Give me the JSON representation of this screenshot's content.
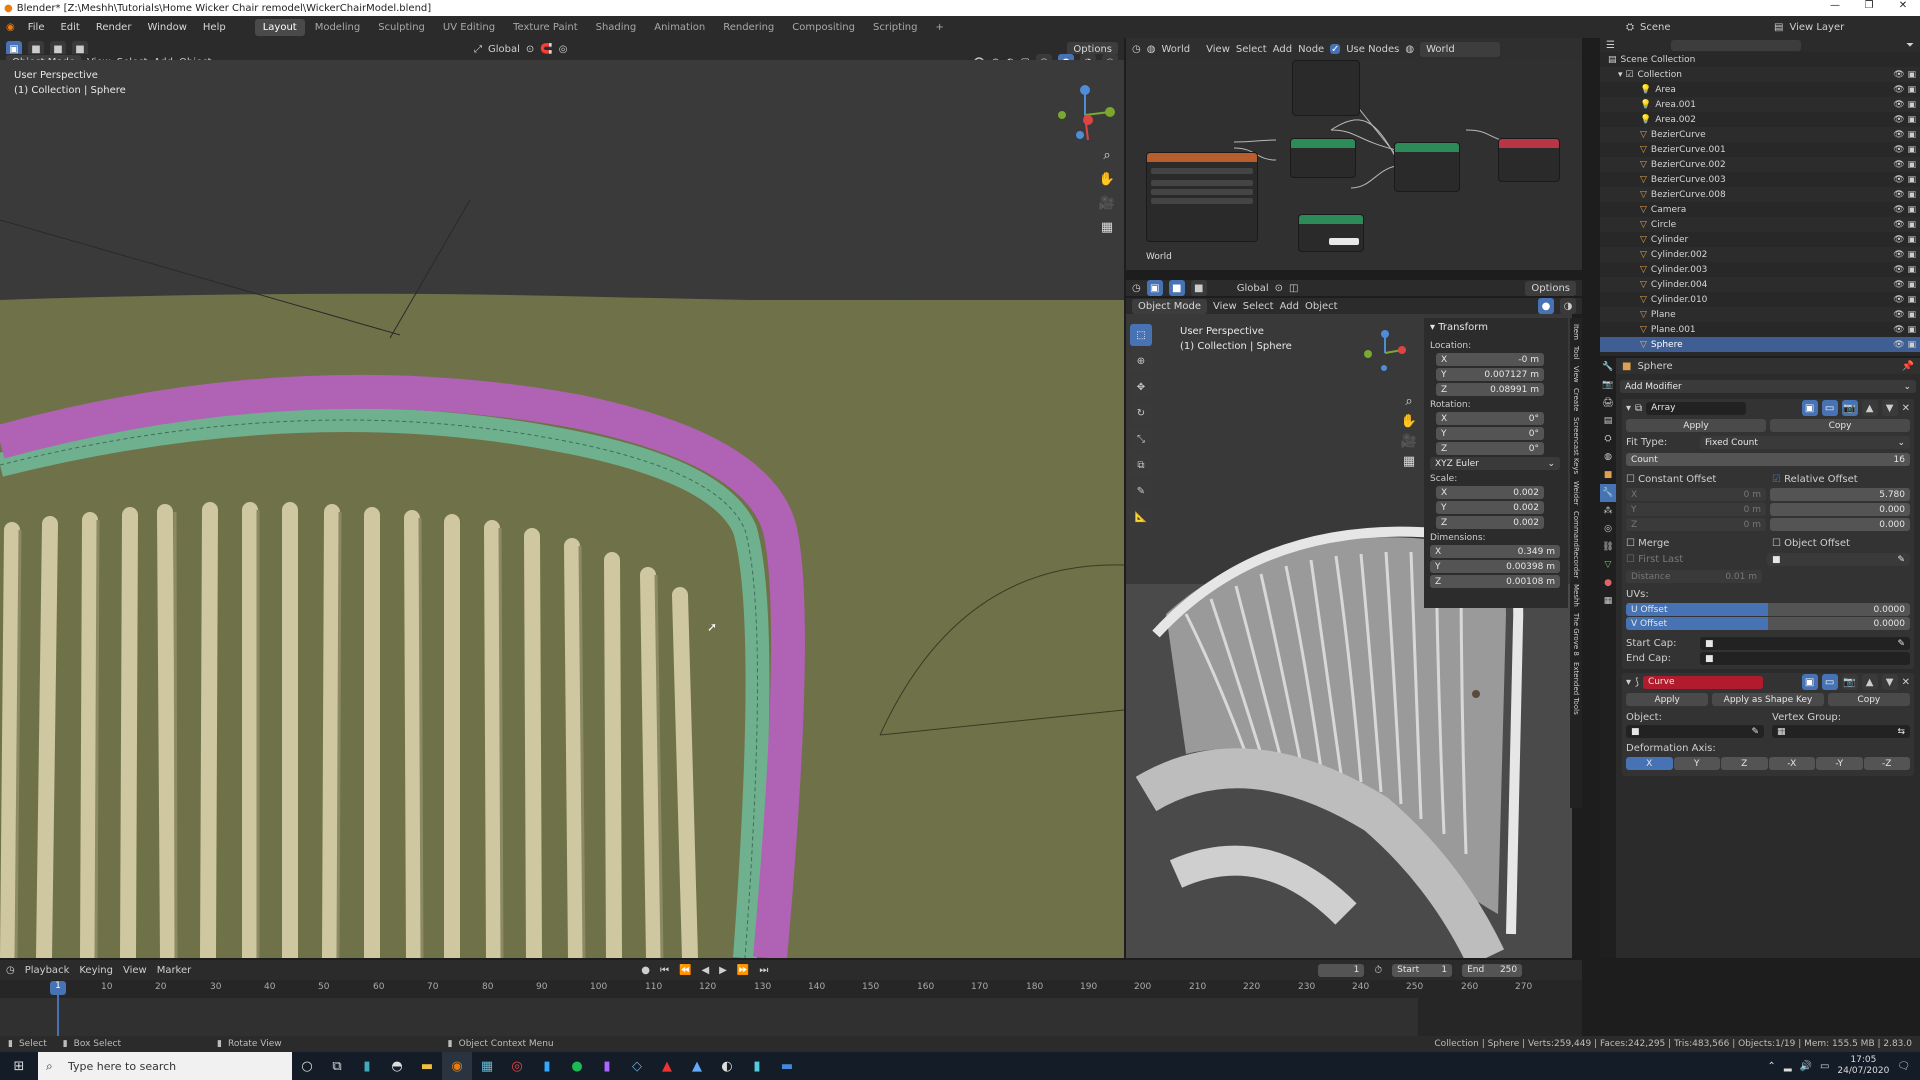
{
  "window": {
    "title": "Blender* [Z:\\Meshh\\Tutorials\\Home Wicker Chair remodel\\WickerChairModel.blend]"
  },
  "menus": [
    "File",
    "Edit",
    "Render",
    "Window",
    "Help"
  ],
  "workspaces": [
    "Layout",
    "Modeling",
    "Sculpting",
    "UV Editing",
    "Texture Paint",
    "Shading",
    "Animation",
    "Rendering",
    "Compositing",
    "Scripting"
  ],
  "active_workspace": "Layout",
  "viewport_header": {
    "mode": "Object Mode",
    "menu": [
      "View",
      "Select",
      "Add",
      "Object"
    ],
    "transform": "Global",
    "options": "Options"
  },
  "viewport_main": {
    "perspective": "User Perspective",
    "collection": "(1) Collection | Sphere"
  },
  "node_editor": {
    "world_label": "World",
    "menu": [
      "View",
      "Select",
      "Add",
      "Node"
    ],
    "use_nodes": "Use Nodes",
    "world_field": "World",
    "footer": "World"
  },
  "viewport_secondary": {
    "mode": "Object Mode",
    "menu": [
      "View",
      "Select",
      "Add",
      "Object"
    ],
    "transform": "Global",
    "options": "Options",
    "perspective": "User Perspective",
    "collection": "(1) Collection | Sphere"
  },
  "transform_panel": {
    "title": "Transform",
    "location_label": "Location:",
    "location": [
      {
        "axis": "X",
        "value": "-0 m"
      },
      {
        "axis": "Y",
        "value": "0.007127 m"
      },
      {
        "axis": "Z",
        "value": "0.08991 m"
      }
    ],
    "rotation_label": "Rotation:",
    "rotation": [
      {
        "axis": "X",
        "value": "0°"
      },
      {
        "axis": "Y",
        "value": "0°"
      },
      {
        "axis": "Z",
        "value": "0°"
      }
    ],
    "rotation_mode": "XYZ Euler",
    "scale_label": "Scale:",
    "scale": [
      {
        "axis": "X",
        "value": "0.002"
      },
      {
        "axis": "Y",
        "value": "0.002"
      },
      {
        "axis": "Z",
        "value": "0.002"
      }
    ],
    "dimensions_label": "Dimensions:",
    "dimensions": [
      {
        "axis": "X",
        "value": "0.349 m"
      },
      {
        "axis": "Y",
        "value": "0.00398 m"
      },
      {
        "axis": "Z",
        "value": "0.00108 m"
      }
    ]
  },
  "outliner": {
    "header": {
      "scene": "Scene",
      "view_layer": "View Layer"
    },
    "root": "Scene Collection",
    "collection": "Collection",
    "items": [
      "Area",
      "Area.001",
      "Area.002",
      "BezierCurve",
      "BezierCurve.001",
      "BezierCurve.002",
      "BezierCurve.003",
      "BezierCurve.008",
      "Camera",
      "Circle",
      "Cylinder",
      "Cylinder.002",
      "Cylinder.003",
      "Cylinder.004",
      "Cylinder.010",
      "Plane",
      "Plane.001",
      "Sphere"
    ],
    "selected": "Sphere"
  },
  "properties": {
    "object_name": "Sphere",
    "add_modifier": "Add Modifier",
    "array": {
      "name": "Array",
      "apply": "Apply",
      "copy": "Copy",
      "fit_type_label": "Fit Type:",
      "fit_type": "Fixed Count",
      "count_label": "Count",
      "count": "16",
      "constant_offset": "Constant Offset",
      "relative_offset": "Relative Offset",
      "constant_values": [
        {
          "axis": "X",
          "value": "0 m"
        },
        {
          "axis": "Y",
          "value": "0 m"
        },
        {
          "axis": "Z",
          "value": "0 m"
        }
      ],
      "relative_values": [
        "5.780",
        "0.000",
        "0.000"
      ],
      "merge": "Merge",
      "first_last": "First Last",
      "distance_label": "Distance",
      "distance": "0.01 m",
      "object_offset": "Object Offset",
      "uvs_label": "UVs:",
      "u_offset_label": "U Offset",
      "u_offset": "0.0000",
      "v_offset_label": "V Offset",
      "v_offset": "0.0000",
      "start_cap": "Start Cap:",
      "end_cap": "End Cap:"
    },
    "curve": {
      "name": "Curve",
      "apply": "Apply",
      "apply_shape": "Apply as Shape Key",
      "copy": "Copy",
      "object_label": "Object:",
      "vertex_group_label": "Vertex Group:",
      "deformation_label": "Deformation Axis:",
      "axes": [
        "X",
        "Y",
        "Z",
        "-X",
        "-Y",
        "-Z"
      ]
    }
  },
  "side_tabs": [
    "Item",
    "Tool",
    "View",
    "Create",
    "Screencast Keys",
    "Weider",
    "CommandRecorder",
    "Meshh",
    "The Grove 8",
    "Extended Tools"
  ],
  "timeline": {
    "menu": [
      "Playback",
      "Keying",
      "View",
      "Marker"
    ],
    "current_frame": "1",
    "start_label": "Start",
    "start": "1",
    "end_label": "End",
    "end": "250",
    "ticks": [
      "1",
      "10",
      "20",
      "30",
      "40",
      "50",
      "60",
      "70",
      "80",
      "90",
      "100",
      "110",
      "120",
      "130",
      "140",
      "150",
      "160",
      "170",
      "180",
      "190",
      "200",
      "210",
      "220",
      "230",
      "240",
      "250",
      "260",
      "270"
    ]
  },
  "statusbar": {
    "select": "Select",
    "box_select": "Box Select",
    "rotate_view": "Rotate View",
    "context_menu": "Object Context Menu",
    "stats": "Collection | Sphere | Verts:259,449 | Faces:242,295 | Tris:483,566 | Objects:1/19 | Mem: 155.5 MB | 2.83.0"
  },
  "taskbar": {
    "search_placeholder": "Type here to search",
    "time": "17:05",
    "date": "24/07/2020"
  },
  "colors": {
    "accent": "#4772b3",
    "viewport_bg": "#6f7248",
    "tube_purple": "#b062b5",
    "tube_green": "#6fb08f"
  }
}
